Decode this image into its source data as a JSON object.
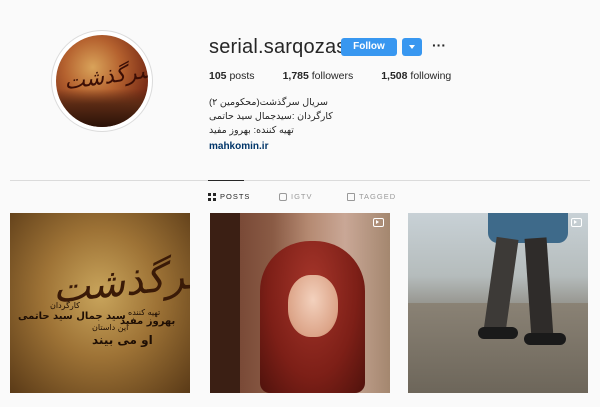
{
  "profile": {
    "username": "serial.sarqozasht",
    "follow_label": "Follow",
    "more_icon": "more-horizontal-icon",
    "avatar_text": "سرگذشت",
    "stats": {
      "posts_count": "105",
      "posts_label": "posts",
      "followers_count": "1,785",
      "followers_label": "followers",
      "following_count": "1,508",
      "following_label": "following"
    },
    "bio": [
      "سریال سرگذشت(محکومین ۲)",
      "کارگردان :سیدجمال سید حاتمی",
      "تهیه کننده: بهروز مفید"
    ],
    "link": "mahkomin.ir"
  },
  "tabs": [
    {
      "label": "POSTS",
      "icon": "grid-icon",
      "active": true
    },
    {
      "label": "IGTV",
      "icon": "tv-icon",
      "active": false
    },
    {
      "label": "TAGGED",
      "icon": "tag-icon",
      "active": false
    }
  ],
  "posts": [
    {
      "type": "image",
      "title": "سرگذشت",
      "credits": {
        "producer_role": "تهیه کننده",
        "producer_name": "بهروز مفید",
        "director_role": "کارگردان",
        "director_name": "سید جمال سید حاتمی",
        "story_text": "این داستان",
        "tagline": "او می بیند"
      }
    },
    {
      "type": "video",
      "icon": "video-icon"
    },
    {
      "type": "video",
      "icon": "video-icon"
    }
  ],
  "colors": {
    "follow_button": "#3897f0",
    "link": "#003569",
    "background": "#fafafa",
    "divider": "#dbdbdb"
  }
}
